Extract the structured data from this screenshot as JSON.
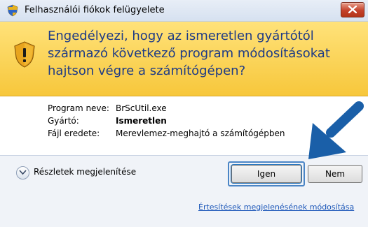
{
  "titlebar": {
    "title": "Felhasználói fiókok felügyelete",
    "icon": "uac-shield-icon",
    "close_icon": "close-icon"
  },
  "banner": {
    "icon": "warning-shield-icon",
    "message": "Engedélyezi, hogy az ismeretlen gyártótól származó következő program módosításokat hajtson végre a számítógépen?"
  },
  "details": {
    "program_label": "Program neve:",
    "program_value": "BrScUtil.exe",
    "publisher_label": "Gyártó:",
    "publisher_value": "Ismeretlen",
    "origin_label": "Fájl eredete:",
    "origin_value": "Merevlemez-meghajtó a számítógépben"
  },
  "footer": {
    "show_details_label": "Részletek megjelenítése",
    "yes_label": "Igen",
    "no_label": "Nem",
    "notification_link": "Értesítések megjelenésének módosítása"
  },
  "colors": {
    "banner_bg": "#f7c73b",
    "banner_text": "#1e3b86",
    "link": "#1b56b8",
    "arrow": "#1a5fa8"
  }
}
